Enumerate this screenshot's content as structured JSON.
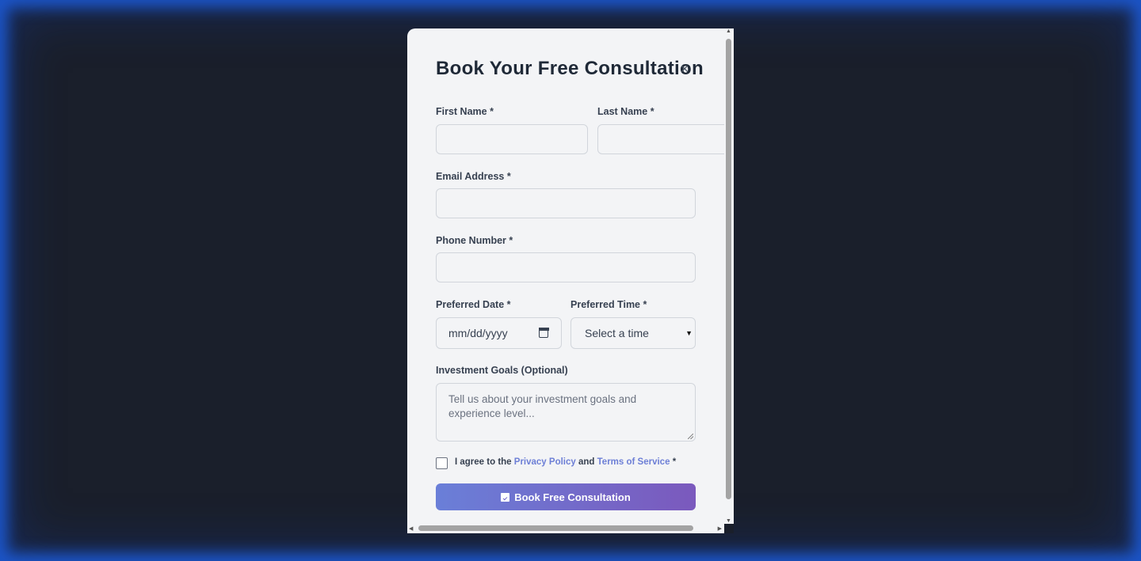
{
  "modal": {
    "title": "Book Your Free Consultation",
    "close_symbol": "×"
  },
  "form": {
    "first_name": {
      "label": "First Name *",
      "value": ""
    },
    "last_name": {
      "label": "Last Name *",
      "value": ""
    },
    "email": {
      "label": "Email Address *",
      "value": ""
    },
    "phone": {
      "label": "Phone Number *",
      "value": ""
    },
    "date": {
      "label": "Preferred Date *",
      "placeholder": "mm/dd/yyyy"
    },
    "time": {
      "label": "Preferred Time *",
      "selected": "Select a time"
    },
    "goals": {
      "label": "Investment Goals (Optional)",
      "placeholder": "Tell us about your investment goals and experience level..."
    },
    "agree": {
      "prefix": "I agree to the",
      "privacy": "Privacy Policy",
      "and": "and",
      "terms": "Terms of Service",
      "suffix": "*",
      "checked": false
    },
    "submit_label": "Book Free Consultation"
  },
  "icons": {
    "close": "close-icon",
    "calendar": "calendar-icon",
    "submit": "calendar-check-icon"
  },
  "colors": {
    "background": "#1a1f2b",
    "glow": "#1e64f0",
    "modal": "#f3f4f6",
    "link": "#6d7fd6",
    "button_start": "#6a7fd8",
    "button_end": "#7b59bd"
  }
}
